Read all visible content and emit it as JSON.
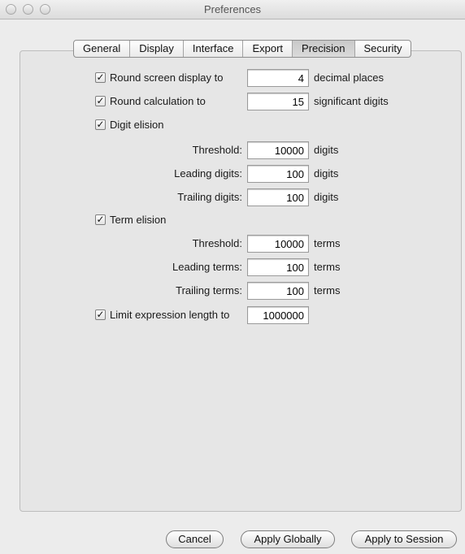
{
  "window": {
    "title": "Preferences"
  },
  "tabs": [
    {
      "label": "General"
    },
    {
      "label": "Display"
    },
    {
      "label": "Interface"
    },
    {
      "label": "Export"
    },
    {
      "label": "Precision",
      "active": true
    },
    {
      "label": "Security"
    }
  ],
  "precision": {
    "round_display": {
      "checked": true,
      "label": "Round screen display to",
      "value": "4",
      "suffix": "decimal places"
    },
    "round_calculation": {
      "checked": true,
      "label": "Round calculation to",
      "value": "15",
      "suffix": "significant digits"
    },
    "digit_elision": {
      "checked": true,
      "label": "Digit elision",
      "threshold": {
        "label": "Threshold:",
        "value": "10000",
        "suffix": "digits"
      },
      "leading": {
        "label": "Leading digits:",
        "value": "100",
        "suffix": "digits"
      },
      "trailing": {
        "label": "Trailing digits:",
        "value": "100",
        "suffix": "digits"
      }
    },
    "term_elision": {
      "checked": true,
      "label": "Term elision",
      "threshold": {
        "label": "Threshold:",
        "value": "10000",
        "suffix": "terms"
      },
      "leading": {
        "label": "Leading terms:",
        "value": "100",
        "suffix": "terms"
      },
      "trailing": {
        "label": "Trailing terms:",
        "value": "100",
        "suffix": "terms"
      }
    },
    "limit_expression": {
      "checked": true,
      "label": "Limit expression length to",
      "value": "1000000"
    }
  },
  "buttons": {
    "cancel": "Cancel",
    "apply_globally": "Apply Globally",
    "apply_session": "Apply to Session"
  },
  "icons": {
    "checkmark": "✓"
  }
}
